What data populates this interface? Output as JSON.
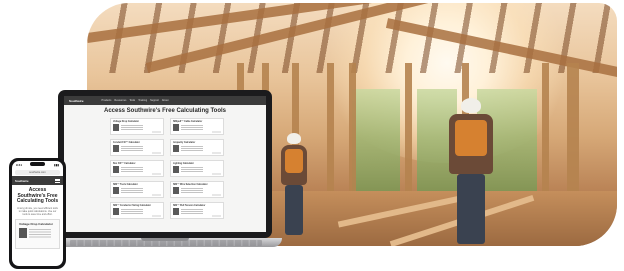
{
  "hero": {
    "scene": "construction-site-photo"
  },
  "laptop": {
    "site_logo": "Southwire",
    "nav_items": [
      "Products",
      "Resources",
      "Tools",
      "Training",
      "Support",
      "About"
    ],
    "page_title": "Access Southwire's Free Calculating Tools",
    "cards": [
      {
        "title": "Voltage Drop Calculator"
      },
      {
        "title": "SIMpull™ Cable Calculator"
      },
      {
        "title": "Conduit Fill™ Calculator"
      },
      {
        "title": "Ampacity Calculator"
      },
      {
        "title": "Box Fill™ Calculator"
      },
      {
        "title": "Lighting Calculator"
      },
      {
        "title": "SIM™ Tools Calculator"
      },
      {
        "title": "SIM™ Wire Selection Calculator"
      },
      {
        "title": "SIM™ Conductor Sizing Calculator"
      },
      {
        "title": "SIM™ Pull Tension Calculator"
      }
    ]
  },
  "phone": {
    "status_time": "9:41",
    "status_icons": "▮▮▮",
    "url": "southwire.com",
    "site_logo": "Southwire",
    "page_title": "Access Southwire's Free Calculating Tools",
    "description": "At any job site, you need efficient tools to make quick calculations. Use our tools to save time and effort.",
    "card_title": "Voltage Drop Calculator"
  }
}
